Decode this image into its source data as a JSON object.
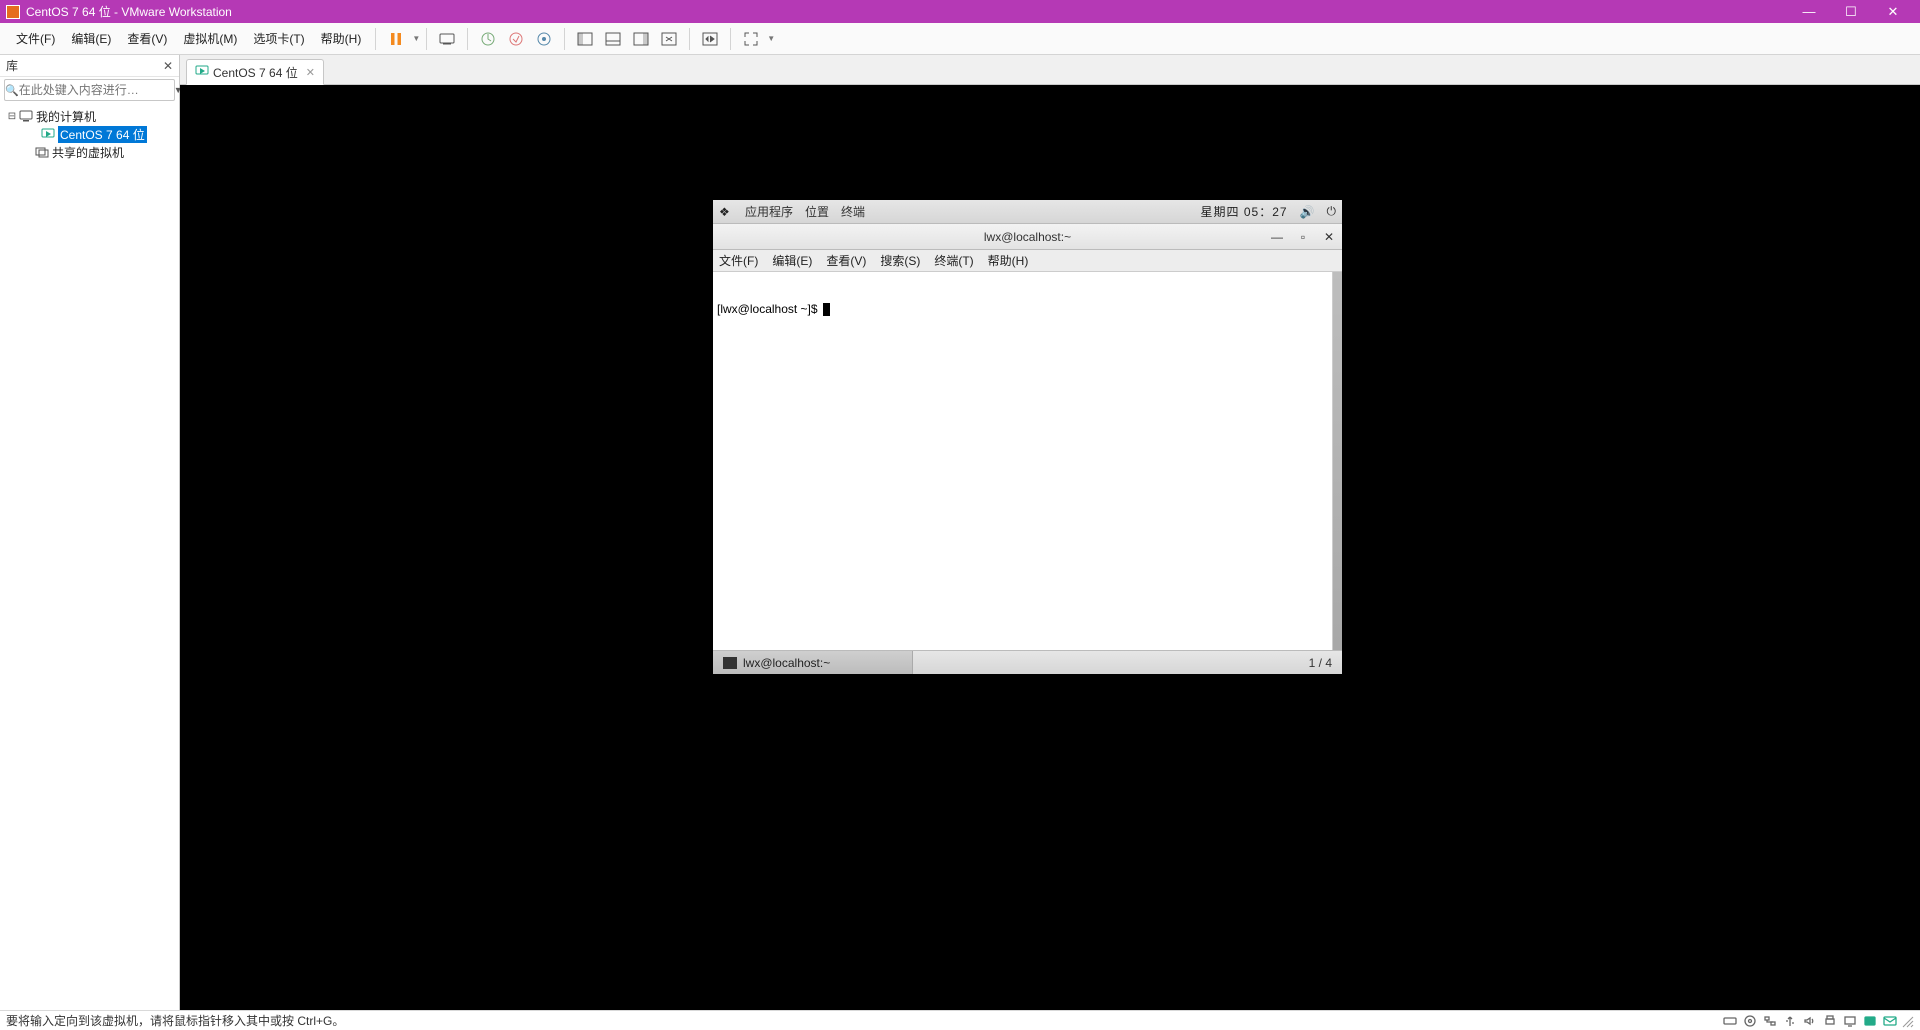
{
  "titlebar": {
    "title": "CentOS 7 64 位 - VMware Workstation"
  },
  "menubar": {
    "items": [
      "文件(F)",
      "编辑(E)",
      "查看(V)",
      "虚拟机(M)",
      "选项卡(T)",
      "帮助(H)"
    ]
  },
  "sidebar": {
    "title": "库",
    "search_placeholder": "在此处键入内容进行…",
    "tree": {
      "root": "我的计算机",
      "vm": "CentOS 7 64 位",
      "shared": "共享的虚拟机"
    }
  },
  "tab": {
    "label": "CentOS 7 64 位"
  },
  "guest": {
    "gnome_top": {
      "apps": "应用程序",
      "places": "位置",
      "terminal": "终端",
      "clock": "星期四 05：27"
    },
    "term_title": "lwx@localhost:~",
    "term_menu": [
      "文件(F)",
      "编辑(E)",
      "查看(V)",
      "搜索(S)",
      "终端(T)",
      "帮助(H)"
    ],
    "prompt": "[lwx@localhost ~]$ ",
    "taskbar": {
      "app": "lwx@localhost:~",
      "workspace": "1 / 4"
    }
  },
  "statusbar": {
    "hint": "要将输入定向到该虚拟机，请将鼠标指针移入其中或按 Ctrl+G。"
  }
}
